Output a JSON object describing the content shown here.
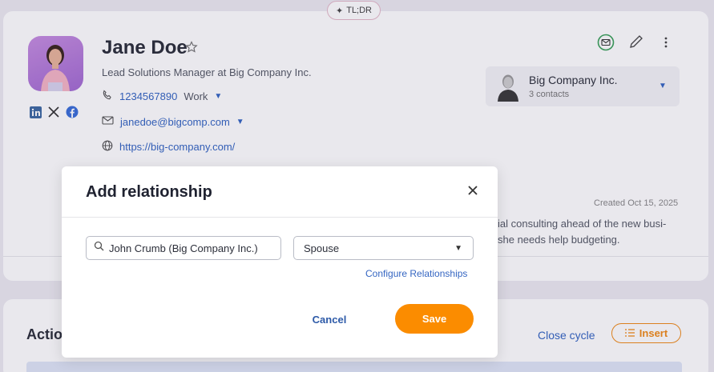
{
  "header": {
    "tldr_label": "TL;DR"
  },
  "contact": {
    "name": "Jane Doe",
    "title": "Lead Solutions Manager at Big Company Inc.",
    "phone": "1234567890",
    "phone_type": "Work",
    "email": "janedoe@bigcomp.com",
    "website": "https://big-company.com/"
  },
  "company": {
    "name": "Big Company Inc.",
    "contacts": "3 contacts"
  },
  "note": {
    "created": "Created Oct 15, 2025",
    "line1": "ial consulting ahead of the new busi-",
    "line2": "she needs help budgeting."
  },
  "actions": {
    "title": "Actio",
    "close_cycle": "Close cycle",
    "insert": "Insert"
  },
  "modal": {
    "title": "Add relationship",
    "search_value": "John Crumb (Big Company Inc.)",
    "relationship_value": "Spouse",
    "configure_link": "Configure Relationships",
    "cancel": "Cancel",
    "save": "Save"
  },
  "colors": {
    "accent": "#fb8c00",
    "link": "#3566c2",
    "avatar_bg": "#b07ad8"
  }
}
